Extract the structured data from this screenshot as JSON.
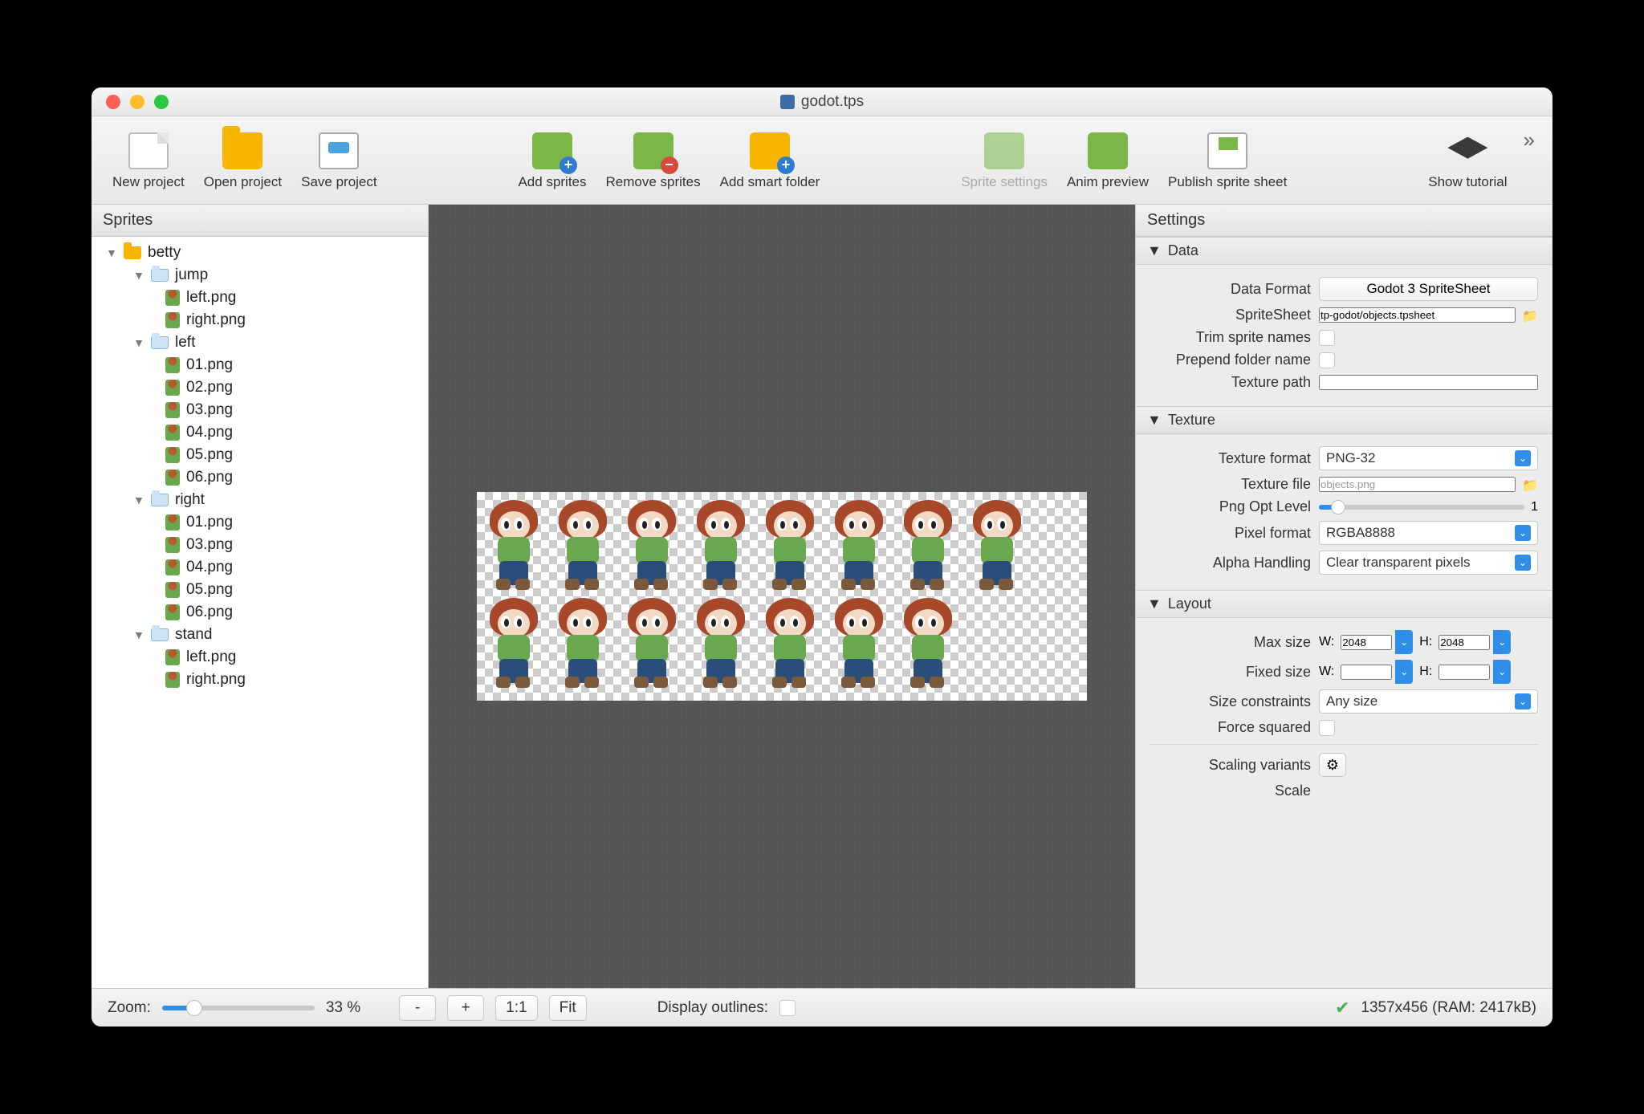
{
  "window": {
    "title": "godot.tps"
  },
  "toolbar": {
    "new_project": "New project",
    "open_project": "Open project",
    "save_project": "Save project",
    "add_sprites": "Add sprites",
    "remove_sprites": "Remove sprites",
    "add_smart_folder": "Add smart folder",
    "sprite_settings": "Sprite settings",
    "anim_preview": "Anim preview",
    "publish": "Publish sprite sheet",
    "show_tutorial": "Show tutorial"
  },
  "sidebar": {
    "header": "Sprites",
    "root": "betty",
    "folders": {
      "jump": {
        "name": "jump",
        "files": [
          "left.png",
          "right.png"
        ]
      },
      "left": {
        "name": "left",
        "files": [
          "01.png",
          "02.png",
          "03.png",
          "04.png",
          "05.png",
          "06.png"
        ]
      },
      "right": {
        "name": "right",
        "files": [
          "01.png",
          "03.png",
          "04.png",
          "05.png",
          "06.png"
        ]
      },
      "stand": {
        "name": "stand",
        "files": [
          "left.png",
          "right.png"
        ]
      }
    }
  },
  "settings": {
    "header": "Settings",
    "data": {
      "section": "Data",
      "data_format_label": "Data Format",
      "data_format_value": "Godot 3 SpriteSheet",
      "spritesheet_label": "SpriteSheet",
      "spritesheet_value": "tp-godot/objects.tpsheet",
      "trim_label": "Trim sprite names",
      "prepend_label": "Prepend folder name",
      "texture_path_label": "Texture path",
      "texture_path_value": ""
    },
    "texture": {
      "section": "Texture",
      "format_label": "Texture format",
      "format_value": "PNG-32",
      "file_label": "Texture file",
      "file_value": "objects.png",
      "png_opt_label": "Png Opt Level",
      "png_opt_value": "1",
      "pixel_format_label": "Pixel format",
      "pixel_format_value": "RGBA8888",
      "alpha_label": "Alpha Handling",
      "alpha_value": "Clear transparent pixels"
    },
    "layout": {
      "section": "Layout",
      "max_size_label": "Max size",
      "max_w": "2048",
      "max_h": "2048",
      "fixed_size_label": "Fixed size",
      "fixed_w": "",
      "fixed_h": "",
      "constraints_label": "Size constraints",
      "constraints_value": "Any size",
      "force_sq_label": "Force squared",
      "scaling_label": "Scaling variants",
      "scale_label": "Scale",
      "w_label": "W:",
      "h_label": "H:"
    }
  },
  "statusbar": {
    "zoom_label": "Zoom:",
    "zoom_value": "33 %",
    "minus": "-",
    "plus": "+",
    "oneone": "1:1",
    "fit": "Fit",
    "outlines_label": "Display outlines:",
    "dims": "1357x456 (RAM: 2417kB)"
  }
}
